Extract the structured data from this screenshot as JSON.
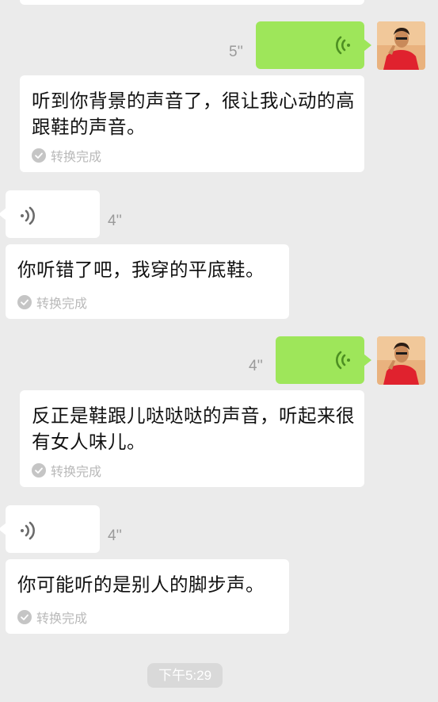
{
  "theme": {
    "background": "#ebebeb",
    "outgoing_bubble": "#9ee65a",
    "incoming_bubble": "#ffffff",
    "avatar_shirt": "#e0222e"
  },
  "messages": [
    {
      "direction": "outgoing",
      "type": "voice",
      "duration": "5''",
      "icon": "voice-wave-icon"
    },
    {
      "type": "transcript",
      "text": "听到你背景的声音了，很让我心动的高跟鞋的声音。",
      "status": "转换完成"
    },
    {
      "direction": "incoming",
      "type": "voice",
      "duration": "4''",
      "icon": "voice-wave-icon"
    },
    {
      "type": "transcript",
      "text": "你听错了吧，我穿的平底鞋。",
      "status": "转换完成"
    },
    {
      "direction": "outgoing",
      "type": "voice",
      "duration": "4''",
      "icon": "voice-wave-icon"
    },
    {
      "type": "transcript",
      "text": "反正是鞋跟儿哒哒哒的声音，听起来很有女人味儿。",
      "status": "转换完成"
    },
    {
      "direction": "incoming",
      "type": "voice",
      "duration": "4''",
      "icon": "voice-wave-icon"
    },
    {
      "type": "transcript",
      "text": "你可能听的是别人的脚步声。",
      "status": "转换完成"
    }
  ],
  "timestamp": "下午5:29"
}
